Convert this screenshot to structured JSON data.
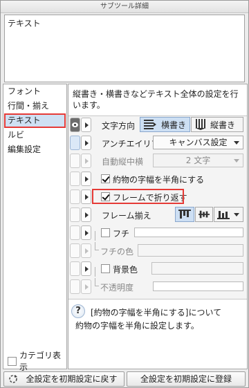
{
  "window": {
    "title": "サブツール詳細"
  },
  "preview": {
    "text": "テキスト"
  },
  "sidebar": {
    "items": [
      {
        "label": "フォント",
        "selected": false
      },
      {
        "label": "行間・揃え",
        "selected": false
      },
      {
        "label": "テキスト",
        "selected": true
      },
      {
        "label": "ルビ",
        "selected": false
      },
      {
        "label": "編集設定",
        "selected": false
      }
    ],
    "category_toggle": {
      "label": "カテゴリ表示",
      "checked": false
    }
  },
  "main": {
    "description": "縦書き・横書きなどテキスト全体の設定を行います。",
    "properties": {
      "direction": {
        "label": "文字方向",
        "horizontal": "横書き",
        "vertical": "縦書き",
        "selected": "横書き"
      },
      "antialias": {
        "label": "アンチエイリアス",
        "value": "キャンバス設定"
      },
      "auto_tcy": {
        "label": "自動縦中横",
        "value": "2 文字"
      },
      "halfwidth": {
        "label": "約物の字幅を半角にする",
        "checked": true
      },
      "wrap": {
        "label": "フレームで折り返す",
        "checked": true
      },
      "frame_align": {
        "label": "フレーム揃え"
      },
      "edge": {
        "label": "フチ",
        "checked": false,
        "color_label": "フチの色"
      },
      "background": {
        "label": "背景色",
        "checked": false,
        "opacity_label": "不透明度"
      }
    },
    "help": {
      "title": "[約物の字幅を半角にする]について",
      "body": "約物の字幅を半角に設定します。"
    }
  },
  "footer": {
    "reset_label": "全設定を初期設定に戻す",
    "register_label": "全設定を初期設定に登録"
  },
  "colors": {
    "selection": "#cfe0f3",
    "highlight": "#e53a36"
  }
}
